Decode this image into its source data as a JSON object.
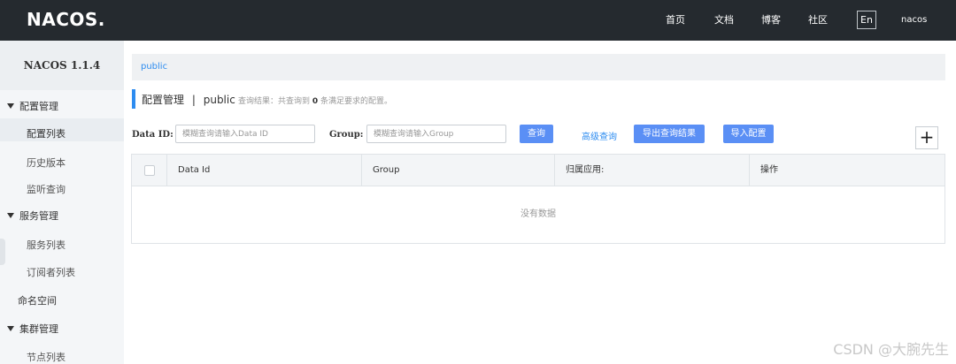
{
  "topbar": {
    "logo": "NACOS.",
    "nav": [
      "首页",
      "文档",
      "博客",
      "社区"
    ],
    "lang": "En",
    "user": "nacos"
  },
  "sidebar": {
    "version": "NACOS 1.1.4",
    "groups": [
      {
        "label": "配置管理",
        "items": [
          "配置列表",
          "历史版本",
          "监听查询"
        ]
      },
      {
        "label": "服务管理",
        "items": [
          "服务列表",
          "订阅者列表"
        ]
      },
      {
        "label": "命名空间"
      },
      {
        "label": "集群管理",
        "items": [
          "节点列表"
        ]
      }
    ]
  },
  "breadcrumb": "public",
  "title": {
    "main": "配置管理",
    "sep": "|",
    "namespace": "public",
    "sub_prefix": "查询结果：共查询到",
    "count": "0",
    "sub_suffix": "条满足要求的配置。"
  },
  "search": {
    "dataid_label": "Data ID:",
    "dataid_placeholder": "模糊查询请输入Data ID",
    "group_label": "Group:",
    "group_placeholder": "模糊查询请输入Group",
    "query_btn": "查询",
    "advanced_link": "高级查询",
    "export_btn": "导出查询结果",
    "import_btn": "导入配置",
    "add_icon": "+"
  },
  "table": {
    "columns": [
      "Data Id",
      "Group",
      "归属应用:",
      "操作"
    ],
    "empty": "没有数据"
  },
  "watermark": "CSDN @大腕先生",
  "colors": {
    "topbar": "#252a2f",
    "accent": "#2d8cf0",
    "button": "#5a8ff5"
  }
}
